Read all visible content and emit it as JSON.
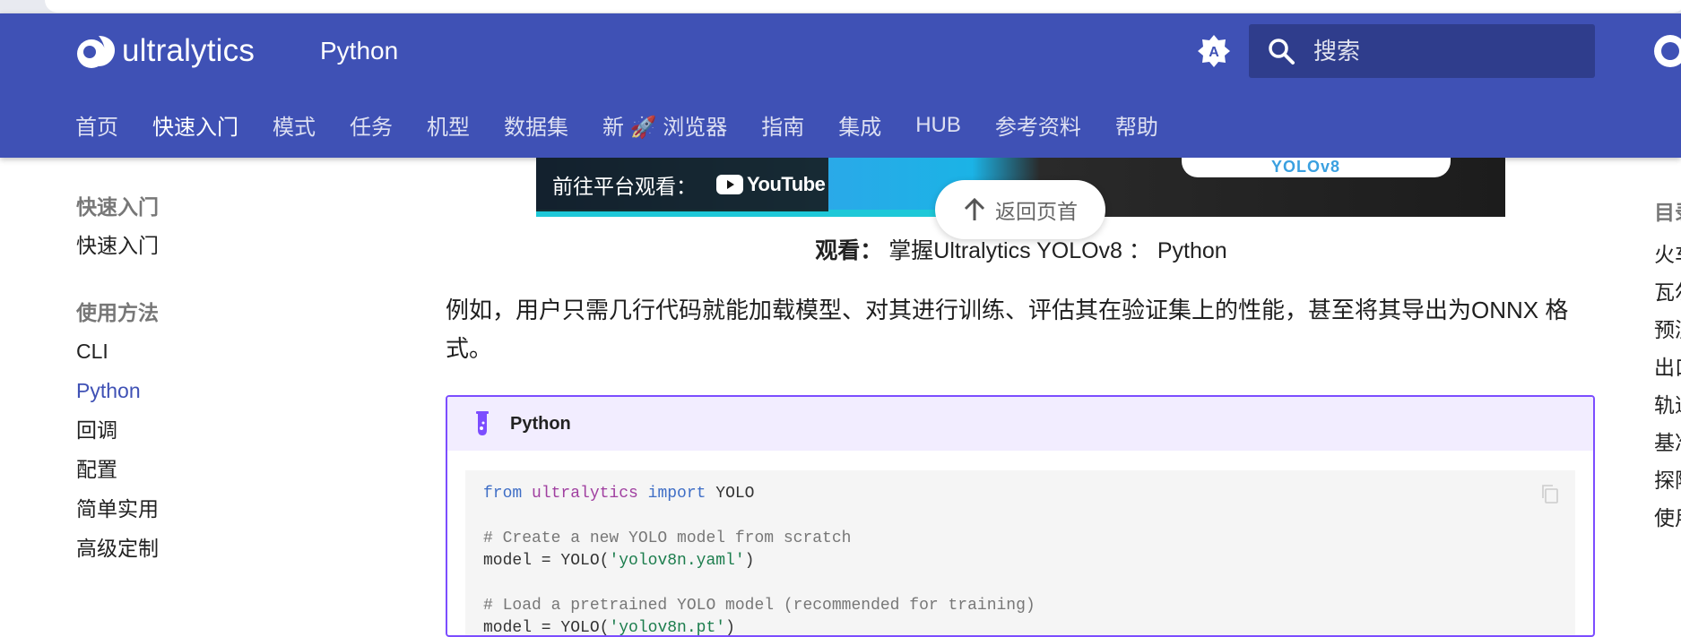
{
  "header": {
    "brand": "ultralytics",
    "site_title": "Python",
    "search_placeholder": "搜索",
    "theme_toggle_letter": "A"
  },
  "tabs": [
    {
      "label": "首页"
    },
    {
      "label": "快速入门"
    },
    {
      "label": "模式"
    },
    {
      "label": "任务"
    },
    {
      "label": "机型"
    },
    {
      "label": "数据集"
    },
    {
      "label": "新 🚀 浏览器"
    },
    {
      "label": "指南"
    },
    {
      "label": "集成"
    },
    {
      "label": "HUB"
    },
    {
      "label": "参考资料"
    },
    {
      "label": "帮助"
    }
  ],
  "sidebar": {
    "section1": "快速入门",
    "section1_items": [
      "快速入门"
    ],
    "section2": "使用方法",
    "section2_items": [
      "CLI",
      "Python",
      "回调",
      "配置",
      "简单实用",
      "高级定制"
    ]
  },
  "video": {
    "watch_label": "前往平台观看：",
    "youtube_label": "YouTube",
    "thumb_text": "YOLOv8"
  },
  "back_to_top": "返回页首",
  "caption": {
    "bold": "观看：",
    "text": " 掌握Ultralytics YOLOv8 ： Python"
  },
  "paragraph": "例如，用户只需几行代码就能加载模型、对其进行训练、评估其在验证集上的性能，甚至将其导出为ONNX 格式。",
  "admonition": {
    "title": "Python",
    "code": [
      {
        "kw1": "from",
        "mod": " ultralytics",
        "kw2": " import",
        "rest": " YOLO"
      },
      {
        "blank": true
      },
      {
        "comment": "# Create a new YOLO model from scratch"
      },
      {
        "pre": "model = YOLO(",
        "str": "'yolov8n.yaml'",
        "post": ")"
      },
      {
        "blank": true
      },
      {
        "comment": "# Load a pretrained YOLO model (recommended for training)"
      },
      {
        "pre": "model = YOLO(",
        "str": "'yolov8n.pt'",
        "post": ")"
      }
    ]
  },
  "toc": {
    "title": "目录",
    "items": [
      "火车",
      "瓦尔",
      "预测",
      "出口",
      "轨道",
      "基准",
      "探险",
      "使用"
    ]
  },
  "colors": {
    "header_bg": "#3f51b5",
    "accent": "#3f51b5",
    "admonition_border": "#7c4dff"
  }
}
